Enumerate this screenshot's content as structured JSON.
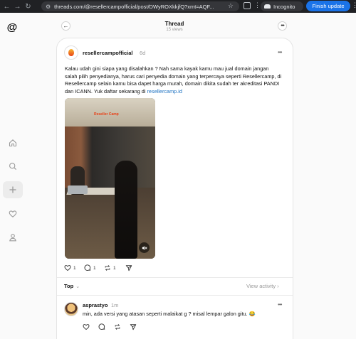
{
  "browser": {
    "url": "threads.com/@resellercampofficial/post/DWyROXkkjfQ?xmt=AQF...",
    "incognito_label": "Incognito",
    "finish_update_label": "Finish update"
  },
  "thread_header": {
    "title": "Thread",
    "views": "15 views"
  },
  "post": {
    "username": "resellercampofficial",
    "time_ago": "6d",
    "text_main": "Kalau udah gini siapa yang disalahkan ? Nah sama kayak kamu mau jual domain jangan salah pilih penyedianya, harus cari penyedia domain yang terpercaya seperti Resellercamp, di Resellercamp selain kamu bisa dapet harga murah, domain dikita sudah ter akreditasi PANDI dan ICANN. Yuk daftar sekarang di ",
    "link_text": "resellercamp.id",
    "video_logo_text": "Reseller Camp",
    "likes": "1",
    "replies": "1",
    "reposts": "1"
  },
  "sort": {
    "label": "Top",
    "view_activity": "View activity"
  },
  "reply": {
    "username": "asprastyo",
    "time_ago": "1m",
    "text": "min, ada versi yang atasan seperti malaikat g ? misal lempar galon gitu. 😂"
  },
  "colors": {
    "chrome_bg": "#202124",
    "finish_button": "#1a73e8",
    "link": "#1d72c2",
    "page_bg": "#fafafa"
  },
  "icons": [
    "threads-logo-icon",
    "home-icon",
    "search-icon",
    "create-icon",
    "heart-icon",
    "profile-icon",
    "back-arrow-icon",
    "more-icon",
    "comment-icon",
    "repost-icon",
    "share-icon",
    "mute-icon"
  ]
}
